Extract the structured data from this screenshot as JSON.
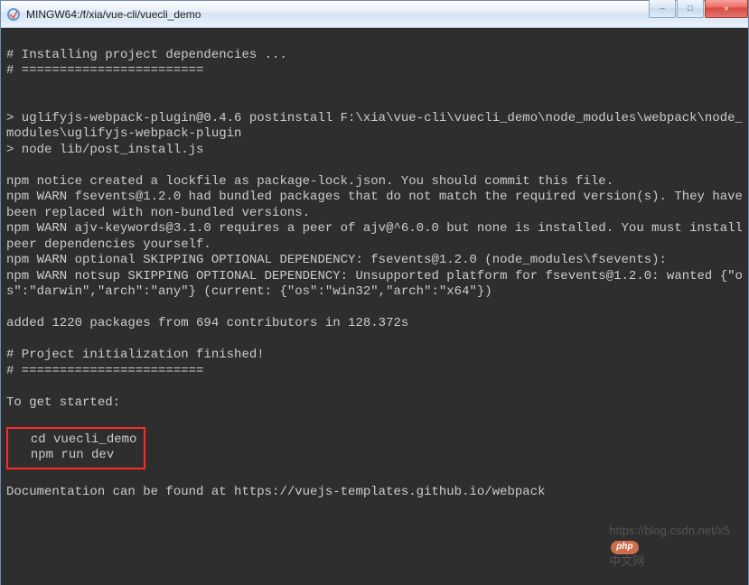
{
  "window": {
    "title": "MINGW64:/f/xia/vue-cli/vuecli_demo"
  },
  "controls": {
    "minimize": "—",
    "maximize": "□",
    "close": "✕"
  },
  "term": {
    "l1": "# Installing project dependencies ...",
    "l2": "# ========================",
    "l3": "> uglifyjs-webpack-plugin@0.4.6 postinstall F:\\xia\\vue-cli\\vuecli_demo\\node_modules\\webpack\\node_modules\\uglifyjs-webpack-plugin",
    "l4": "> node lib/post_install.js",
    "l5": "npm notice created a lockfile as package-lock.json. You should commit this file.",
    "l6": "npm WARN fsevents@1.2.0 had bundled packages that do not match the required version(s). They have been replaced with non-bundled versions.",
    "l7": "npm WARN ajv-keywords@3.1.0 requires a peer of ajv@^6.0.0 but none is installed. You must install peer dependencies yourself.",
    "l8": "npm WARN optional SKIPPING OPTIONAL DEPENDENCY: fsevents@1.2.0 (node_modules\\fsevents):",
    "l9": "npm WARN notsup SKIPPING OPTIONAL DEPENDENCY: Unsupported platform for fsevents@1.2.0: wanted {\"os\":\"darwin\",\"arch\":\"any\"} (current: {\"os\":\"win32\",\"arch\":\"x64\"})",
    "l10": "added 1220 packages from 694 contributors in 128.372s",
    "l11": "# Project initialization finished!",
    "l12": "# ========================",
    "l13": "To get started:",
    "hl1": "cd vuecli_demo",
    "hl2": "npm run dev",
    "l14": "Documentation can be found at https://vuejs-templates.github.io/webpack"
  },
  "watermark": {
    "url": "https://blog.csdn.net/x5",
    "badge": "php",
    "tail": "中文网"
  }
}
